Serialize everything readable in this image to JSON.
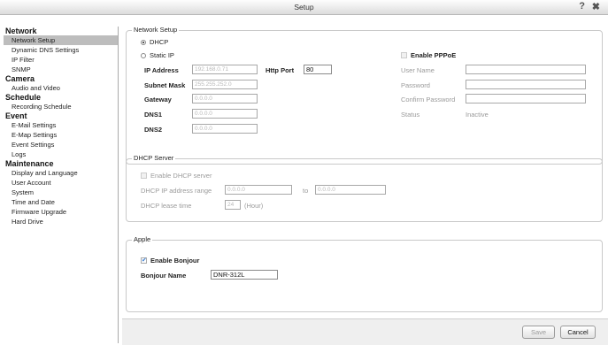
{
  "window": {
    "title": "Setup",
    "help_glyph": "?",
    "close_glyph": "✖"
  },
  "sidebar": [
    {
      "type": "cat",
      "label": "Network"
    },
    {
      "type": "item",
      "label": "Network Setup",
      "active": true
    },
    {
      "type": "item",
      "label": "Dynamic DNS Settings"
    },
    {
      "type": "item",
      "label": "IP Filter"
    },
    {
      "type": "item",
      "label": "SNMP"
    },
    {
      "type": "cat",
      "label": "Camera"
    },
    {
      "type": "item",
      "label": "Audio and Video"
    },
    {
      "type": "cat",
      "label": "Schedule"
    },
    {
      "type": "item",
      "label": "Recording Schedule"
    },
    {
      "type": "cat",
      "label": "Event"
    },
    {
      "type": "item",
      "label": "E-Mail Settings"
    },
    {
      "type": "item",
      "label": "E-Map Settings"
    },
    {
      "type": "item",
      "label": "Event Settings"
    },
    {
      "type": "item",
      "label": "Logs"
    },
    {
      "type": "cat",
      "label": "Maintenance"
    },
    {
      "type": "item",
      "label": "Display and Language"
    },
    {
      "type": "item",
      "label": "User Account"
    },
    {
      "type": "item",
      "label": "System"
    },
    {
      "type": "item",
      "label": "Time and Date"
    },
    {
      "type": "item",
      "label": "Firmware Upgrade"
    },
    {
      "type": "item",
      "label": "Hard Drive"
    }
  ],
  "network_setup": {
    "legend": "Network Setup",
    "dhcp_label": "DHCP",
    "dhcp_selected": true,
    "static_ip_label": "Static IP",
    "ip_address_label": "IP Address",
    "ip_address_value": "192.168.0.71",
    "http_port_label": "Http Port",
    "http_port_value": "80",
    "subnet_mask_label": "Subnet Mask",
    "subnet_mask_value": "255.255.252.0",
    "gateway_label": "Gateway",
    "gateway_value": "0.0.0.0",
    "dns1_label": "DNS1",
    "dns1_value": "0.0.0.0",
    "dns2_label": "DNS2",
    "dns2_value": "0.0.0.0",
    "enable_pppoe_label": "Enable PPPoE",
    "user_name_label": "User Name",
    "password_label": "Password",
    "confirm_password_label": "Confirm Password",
    "status_label": "Status",
    "status_value": "Inactive"
  },
  "dhcp_server": {
    "legend": "DHCP Server",
    "enable_label": "Enable DHCP server",
    "range_label": "DHCP IP address range",
    "range_start": "0.0.0.0",
    "to_label": "to",
    "range_end": "0.0.0.0",
    "lease_label": "DHCP lease time",
    "lease_value": "24",
    "lease_unit": "(Hour)"
  },
  "apple": {
    "legend": "Apple",
    "enable_bonjour_label": "Enable Bonjour",
    "enable_bonjour_checked": true,
    "bonjour_name_label": "Bonjour Name",
    "bonjour_name_value": "DNR-312L"
  },
  "footer": {
    "save_label": "Save",
    "cancel_label": "Cancel"
  }
}
